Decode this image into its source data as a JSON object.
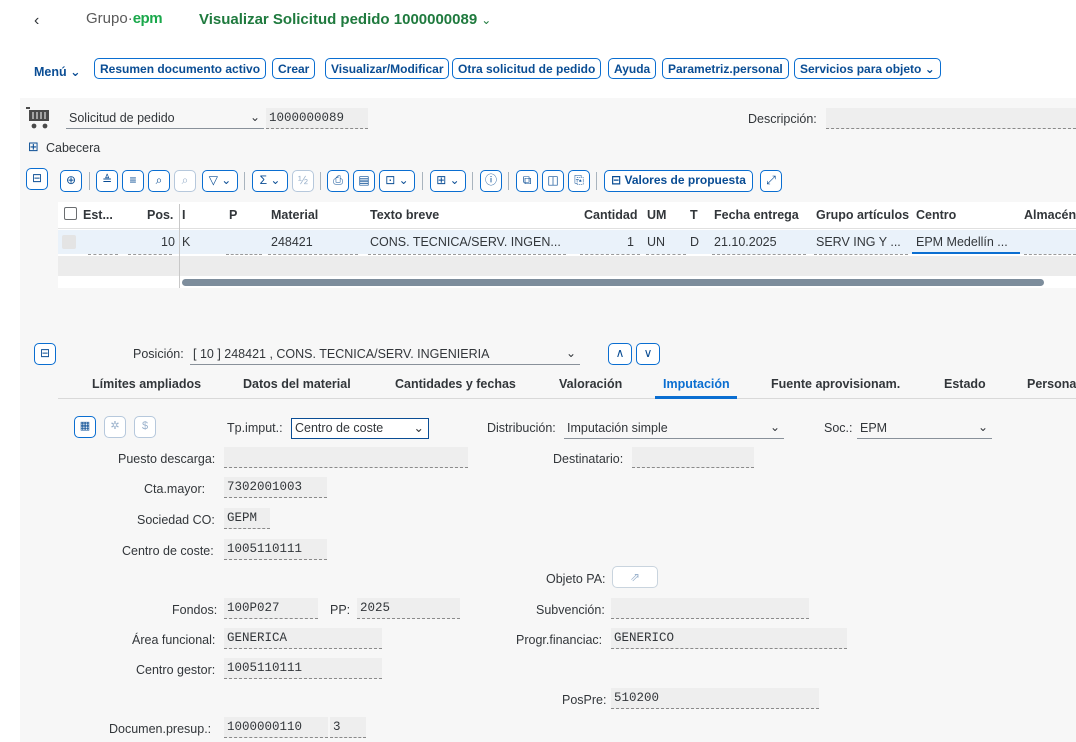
{
  "header": {
    "back_icon": "‹",
    "logo_prefix": "Grupo·",
    "logo_brand": "epm",
    "title": "Visualizar Solicitud pedido 1000000089",
    "title_chevron": "⌄"
  },
  "toolbar": {
    "menu_label": "Menú",
    "buttons": [
      "Resumen documento activo",
      "Crear",
      "Visualizar/Modificar",
      "Otra solicitud de pedido",
      "Ayuda",
      "Parametriz.personal",
      "Servicios para objeto"
    ]
  },
  "doc": {
    "doc_type": "Solicitud de pedido",
    "doc_number": "1000000089",
    "description_label": "Descripción:",
    "description_value": "",
    "cabecera_label": "Cabecera"
  },
  "grid_toolbar": {
    "valores_label": "Valores de propuesta"
  },
  "table": {
    "columns": [
      "Est...",
      "Pos.",
      "I",
      "P",
      "Material",
      "Texto breve",
      "Cantidad",
      "UM",
      "T",
      "Fecha entrega",
      "Grupo artículos",
      "Centro",
      "Almacén"
    ],
    "row": {
      "pos": "10",
      "i": "K",
      "material": "248421",
      "texto": "CONS. TECNICA/SERV. INGEN...",
      "cantidad": "1",
      "um": "UN",
      "t": "D",
      "fecha": "21.10.2025",
      "grupo": "SERV ING Y ...",
      "centro": "EPM Medellín ..."
    }
  },
  "item": {
    "label": "Posición:",
    "value": "[ 10 ] 248421 , CONS. TECNICA/SERV. INGENIERIA"
  },
  "tabs": [
    "Límites ampliados",
    "Datos del material",
    "Cantidades y fechas",
    "Valoración",
    "Imputación",
    "Fuente aprovisionam.",
    "Estado",
    "Persona"
  ],
  "form": {
    "tp_imput_label": "Tp.imput.:",
    "tp_imput_value": "Centro de coste",
    "distribucion_label": "Distribución:",
    "distribucion_value": "Imputación simple",
    "soc_label": "Soc.:",
    "soc_value": "EPM",
    "puesto_label": "Puesto descarga:",
    "puesto_value": "",
    "destinatario_label": "Destinatario:",
    "destinatario_value": "",
    "cta_label": "Cta.mayor:",
    "cta_value": "7302001003",
    "sociedad_co_label": "Sociedad CO:",
    "sociedad_co_value": "GEPM",
    "centro_coste_label": "Centro de coste:",
    "centro_coste_value": "1005110111",
    "objeto_pa_label": "Objeto PA:",
    "fondos_label": "Fondos:",
    "fondos_value": "100P027",
    "pp_label": "PP:",
    "pp_value": "2025",
    "subvencion_label": "Subvención:",
    "subvencion_value": "",
    "area_label": "Área funcional:",
    "area_value": "GENERICA",
    "progr_label": "Progr.financiac:",
    "progr_value": "GENERICO",
    "centro_gestor_label": "Centro gestor:",
    "centro_gestor_value": "1005110111",
    "pospre_label": "PosPre:",
    "pospre_value": "510200",
    "documen_label": "Documen.presup.:",
    "documen_value": "1000000110",
    "documen_pos": "3"
  }
}
